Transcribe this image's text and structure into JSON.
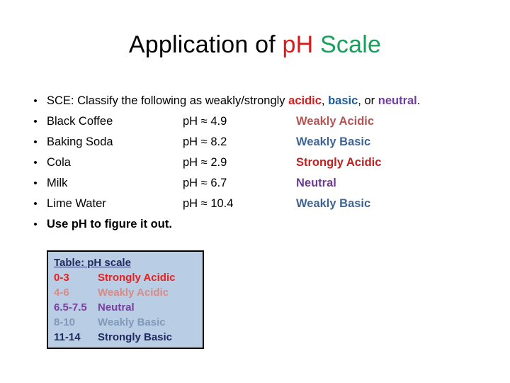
{
  "title": {
    "part_black": "Application of ",
    "part_red": "pH",
    "part_green": " Scale"
  },
  "instruction": {
    "lead": "SCE: Classify the following as weakly/strongly ",
    "kw_acidic": "acidic",
    "sep1": ", ",
    "kw_basic": "basic",
    "sep2": ", or ",
    "kw_neutral": "neutral",
    "end": "."
  },
  "bullet_mark": "•",
  "items": [
    {
      "substance": "Black Coffee",
      "ph": "pH ≈ 4.9",
      "answer": "Weakly Acidic"
    },
    {
      "substance": "Baking Soda",
      "ph": "pH ≈ 8.2",
      "answer": "Weakly Basic"
    },
    {
      "substance": "Cola",
      "ph": "pH ≈ 2.9",
      "answer": "Strongly Acidic"
    },
    {
      "substance": "Milk",
      "ph": "pH ≈ 6.7",
      "answer": "Neutral"
    },
    {
      "substance": "Lime Water",
      "ph": "pH ≈ 10.4",
      "answer": "Weakly Basic"
    }
  ],
  "closing_bullet": "Use pH to figure it out.",
  "ph_table": {
    "title": "Table: pH scale",
    "rows": [
      {
        "range": "0-3",
        "label": "Strongly Acidic"
      },
      {
        "range": "4-6",
        "label": "Weakly Acidic"
      },
      {
        "range": "6.5-7.5",
        "label": "Neutral"
      },
      {
        "range": "8-10",
        "label": "Weakly Basic"
      },
      {
        "range": "11-14",
        "label": "Strongly Basic"
      }
    ]
  },
  "colors": {
    "title_red": "#d91b1b",
    "title_green": "#17a05c",
    "keyword_acidic": "#d91b1b",
    "keyword_basic": "#1f5c9e",
    "keyword_neutral": "#6f3f9e",
    "answer_weak_acidic": "#b55352",
    "answer_weak_basic": "#3f6494",
    "answer_strong_acidic": "#c0201f",
    "answer_neutral": "#6b3d91",
    "table_background": "#b9cde4",
    "table_border": "#000000",
    "table_title": "#1f2a5e",
    "table_strong_acidic": "#e8201d",
    "table_weak_acidic": "#d98a84",
    "table_neutral": "#7a3f9e",
    "table_weak_basic": "#8099b8",
    "table_strong_basic": "#1f2a5e"
  }
}
